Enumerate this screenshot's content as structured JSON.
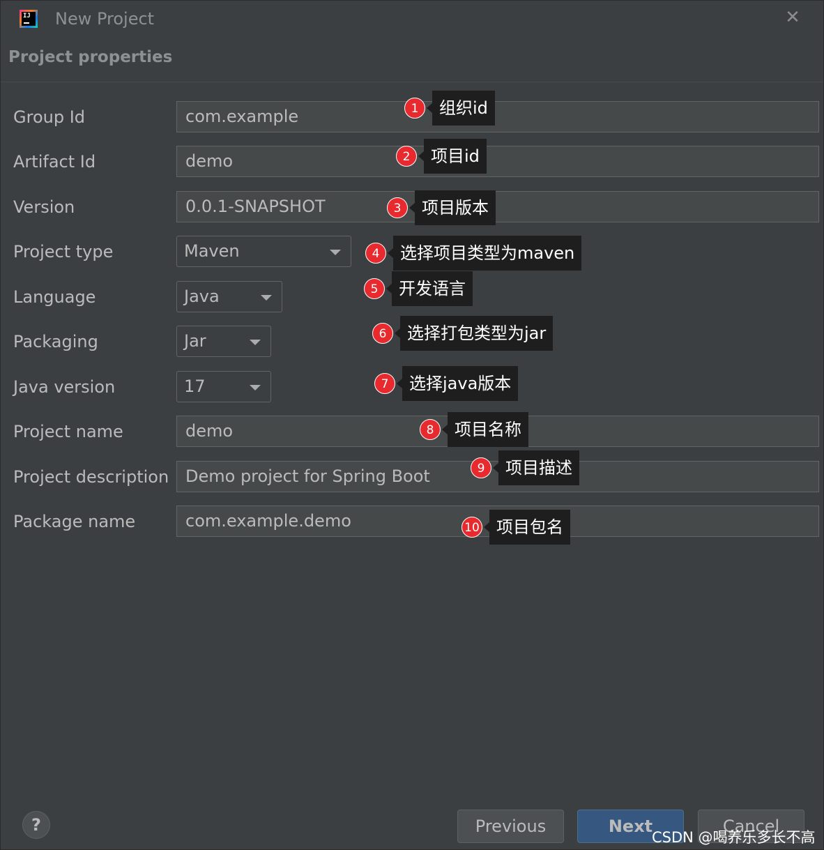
{
  "window": {
    "title": "New Project",
    "app_icon_text": "IJ"
  },
  "section_title": "Project properties",
  "fields": {
    "group_id": {
      "label": "Group Id",
      "value": "com.example"
    },
    "artifact_id": {
      "label": "Artifact Id",
      "value": "demo"
    },
    "version": {
      "label": "Version",
      "value": "0.0.1-SNAPSHOT"
    },
    "project_type": {
      "label": "Project type",
      "value": "Maven"
    },
    "language": {
      "label": "Language",
      "value": "Java"
    },
    "packaging": {
      "label": "Packaging",
      "value": "Jar"
    },
    "java_version": {
      "label": "Java version",
      "value": "17"
    },
    "project_name": {
      "label": "Project name",
      "value": "demo"
    },
    "project_description": {
      "label": "Project description",
      "value": "Demo project for Spring Boot"
    },
    "package_name": {
      "label": "Package name",
      "value": "com.example.demo"
    }
  },
  "annotations": [
    {
      "num": "1",
      "text": "组织id"
    },
    {
      "num": "2",
      "text": "项目id"
    },
    {
      "num": "3",
      "text": "项目版本"
    },
    {
      "num": "4",
      "text": "选择项目类型为maven"
    },
    {
      "num": "5",
      "text": "开发语言"
    },
    {
      "num": "6",
      "text": "选择打包类型为jar"
    },
    {
      "num": "7",
      "text": "选择java版本"
    },
    {
      "num": "8",
      "text": "项目名称"
    },
    {
      "num": "9",
      "text": "项目描述"
    },
    {
      "num": "10",
      "text": "项目包名"
    }
  ],
  "buttons": {
    "help": "?",
    "previous": "Previous",
    "next": "Next",
    "cancel": "Cancel"
  },
  "watermark": "CSDN @喝养乐多长不高",
  "icons": {
    "close": "close-icon",
    "help": "help-icon",
    "dropdown": "chevron-down-icon"
  },
  "colors": {
    "background": "#3c3f41",
    "field_bg": "#45494a",
    "next_button": "#365880",
    "annotation_badge": "#e8292e",
    "annotation_box": "#1e1e1e"
  }
}
